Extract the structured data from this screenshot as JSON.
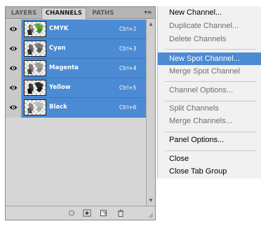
{
  "panel": {
    "tabs": [
      {
        "label": "LAYERS",
        "active": false
      },
      {
        "label": "CHANNELS",
        "active": true
      },
      {
        "label": "PATHS",
        "active": false
      }
    ],
    "menu_button_icon": "panel-menu-icon",
    "channels": [
      {
        "name": "CMYK",
        "shortcut": "Ctrl+2"
      },
      {
        "name": "Cyan",
        "shortcut": "Ctrl+3"
      },
      {
        "name": "Magenta",
        "shortcut": "Ctrl+4"
      },
      {
        "name": "Yellow",
        "shortcut": "Ctrl+5"
      },
      {
        "name": "Black",
        "shortcut": "Ctrl+6"
      }
    ],
    "bottom_icons": [
      "load-selection-icon",
      "save-selection-icon",
      "new-channel-icon",
      "delete-channel-icon"
    ],
    "colors": {
      "selection": "#4b8bd4",
      "panel_bg": "#d6d6d6",
      "tab_bar": "#b5b5b5"
    }
  },
  "menu": {
    "groups": [
      [
        {
          "label": "New Channel...",
          "disabled": false,
          "highlighted": false
        },
        {
          "label": "Duplicate Channel...",
          "disabled": true,
          "highlighted": false
        },
        {
          "label": "Delete Channels",
          "disabled": true,
          "highlighted": false
        }
      ],
      [
        {
          "label": "New Spot Channel...",
          "disabled": false,
          "highlighted": true
        },
        {
          "label": "Merge Spot Channel",
          "disabled": true,
          "highlighted": false
        }
      ],
      [
        {
          "label": "Channel Options...",
          "disabled": true,
          "highlighted": false
        }
      ],
      [
        {
          "label": "Split Channels",
          "disabled": true,
          "highlighted": false
        },
        {
          "label": "Merge Channels...",
          "disabled": true,
          "highlighted": false
        }
      ],
      [
        {
          "label": "Panel Options...",
          "disabled": false,
          "highlighted": false
        }
      ],
      [
        {
          "label": "Close",
          "disabled": false,
          "highlighted": false
        },
        {
          "label": "Close Tab Group",
          "disabled": false,
          "highlighted": false
        }
      ]
    ]
  }
}
